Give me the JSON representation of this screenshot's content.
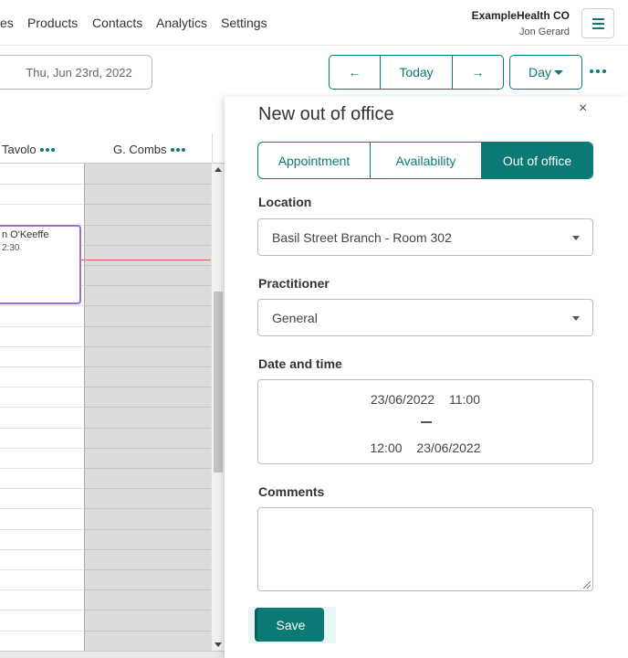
{
  "nav": {
    "items": [
      "es",
      "Products",
      "Contacts",
      "Analytics",
      "Settings"
    ],
    "org_name": "ExampleHealth CO",
    "user_name": "Jon Gerard",
    "menu_icon": "hamburger-icon"
  },
  "toolbar": {
    "date": "Thu, Jun 23rd, 2022",
    "prev": "←",
    "today": "Today",
    "next": "→",
    "view": "Day",
    "more_icon": "more-horizontal-icon"
  },
  "calendar": {
    "columns": [
      {
        "name": "Tavolo",
        "menu_icon": "more-horizontal-icon"
      },
      {
        "name": "G. Combs",
        "menu_icon": "more-horizontal-icon"
      }
    ],
    "event": {
      "title": "n O'Keeffe",
      "time": "2:30"
    }
  },
  "panel": {
    "title": "New out of office",
    "close": "×",
    "tabs": [
      "Appointment",
      "Availability",
      "Out of office"
    ],
    "active_tab": "Out of office",
    "location_label": "Location",
    "location_value": "Basil Street Branch - Room 302",
    "practitioner_label": "Practitioner",
    "practitioner_value": "General",
    "datetime_label": "Date and time",
    "start_date": "23/06/2022",
    "start_time": "11:00",
    "end_time": "12:00",
    "end_date": "23/06/2022",
    "comments_label": "Comments",
    "comments_value": "",
    "save": "Save"
  },
  "colors": {
    "accent": "#0b7a75",
    "event_border": "#9b6fd1",
    "now_line": "#e05a5a",
    "unavailable": "#dcdcdc"
  }
}
